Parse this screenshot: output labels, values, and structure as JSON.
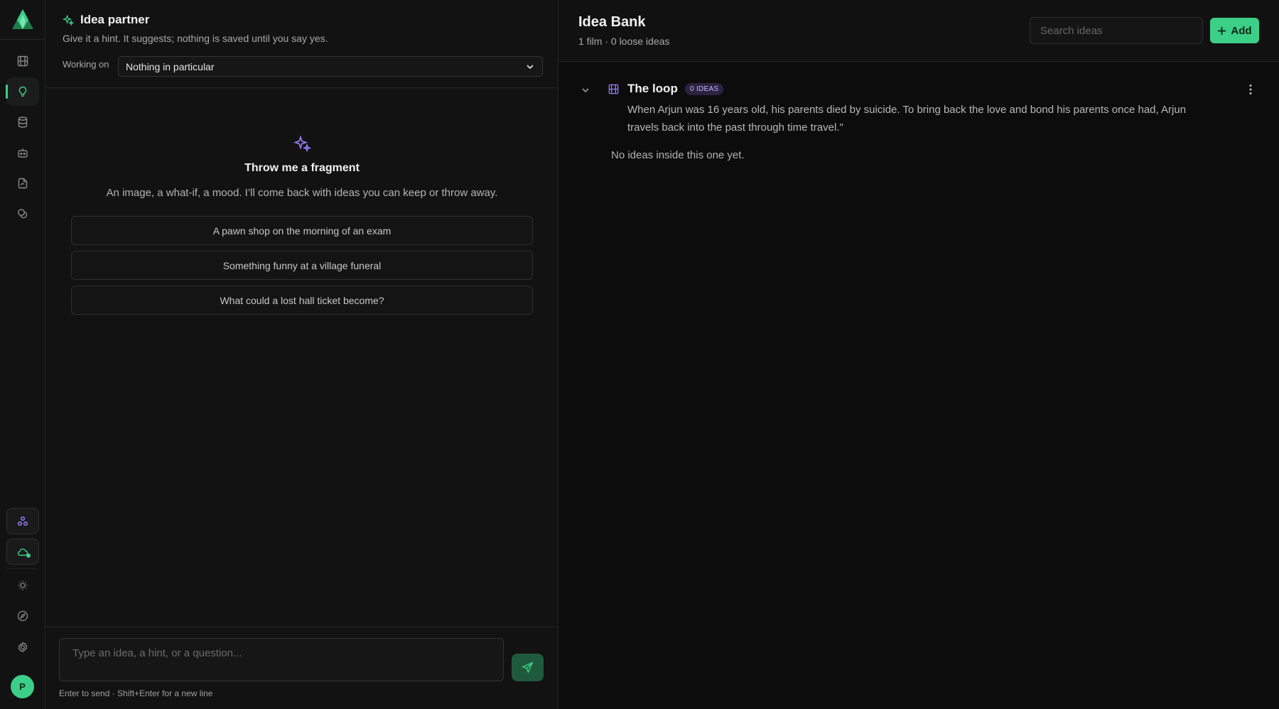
{
  "rail": {
    "icons": [
      "film-icon",
      "lightbulb-icon",
      "database-icon",
      "robot-icon",
      "file-sync-icon",
      "coins-icon"
    ],
    "bottom_icons": [
      "network-icon",
      "cloud-icon",
      "sun-icon",
      "compass-icon",
      "gear-icon"
    ],
    "avatar_initial": "P",
    "accent": "#3ccf87"
  },
  "chat": {
    "title": "Idea partner",
    "subtitle": "Give it a hint. It suggests; nothing is saved until you say yes.",
    "working_label": "Working on",
    "working_value": "Nothing in particular",
    "empty_title": "Throw me a fragment",
    "empty_subtitle": "An image, a what-if, a mood. I’ll come back with ideas you can keep or throw away.",
    "suggestions": [
      "A pawn shop on the morning of an exam",
      "Something funny at a village funeral",
      "What could a lost hall ticket become?"
    ],
    "composer_placeholder": "Type an idea, a hint, or a question...",
    "composer_hint": "Enter to send · Shift+Enter for a new line"
  },
  "bank": {
    "title": "Idea Bank",
    "subtitle": "1 film · 0 loose ideas",
    "search_placeholder": "Search ideas",
    "add_label": "Add",
    "films": [
      {
        "title": "The loop",
        "badge": "0 IDEAS",
        "logline": "When Arjun was 16 years old, his parents died by suicide. To bring back the love and bond his parents once had, Arjun travels back into the past through time travel.\"",
        "empty_text": "No ideas inside this one yet."
      }
    ]
  }
}
